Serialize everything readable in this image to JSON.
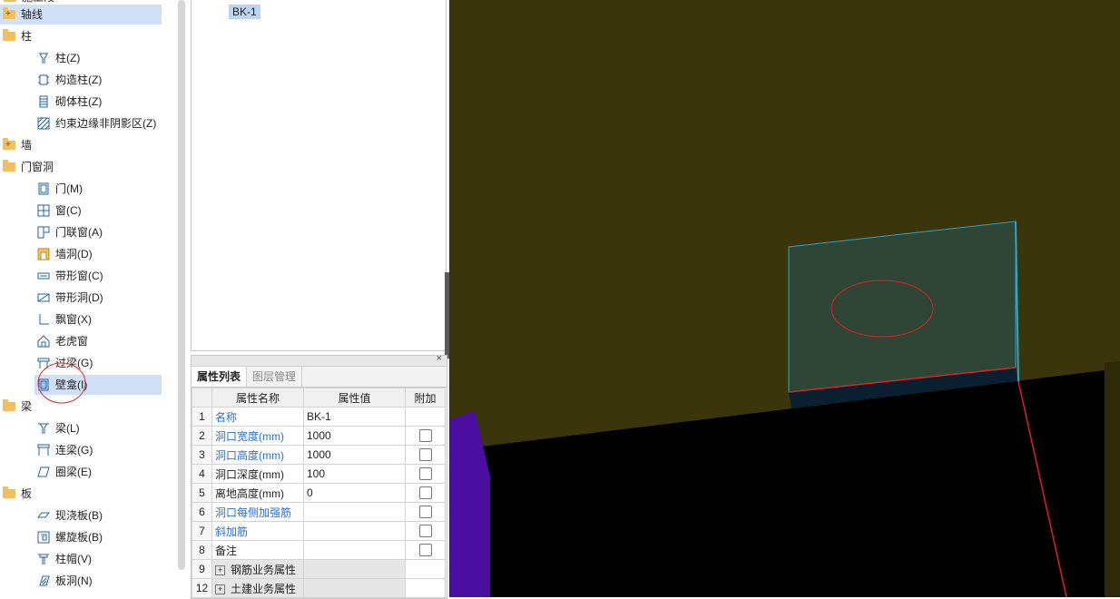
{
  "tree": {
    "top_cut_label": "施工段",
    "items": [
      {
        "label": "轴线",
        "type": "folder",
        "level": 0,
        "selected": true
      },
      {
        "label": "柱",
        "type": "folder",
        "level": 0
      },
      {
        "label": "柱(Z)",
        "type": "leaf",
        "icon": "column-icon",
        "level": 1
      },
      {
        "label": "构造柱(Z)",
        "type": "leaf",
        "icon": "structural-column-icon",
        "level": 1
      },
      {
        "label": "砌体柱(Z)",
        "type": "leaf",
        "icon": "masonry-column-icon",
        "level": 1
      },
      {
        "label": "约束边缘非阴影区(Z)",
        "type": "leaf",
        "icon": "hatched-zone-icon",
        "level": 1
      },
      {
        "label": "墙",
        "type": "folder",
        "level": 0
      },
      {
        "label": "门窗洞",
        "type": "folder",
        "level": 0
      },
      {
        "label": "门(M)",
        "type": "leaf",
        "icon": "door-icon",
        "level": 1
      },
      {
        "label": "窗(C)",
        "type": "leaf",
        "icon": "window-icon",
        "level": 1
      },
      {
        "label": "门联窗(A)",
        "type": "leaf",
        "icon": "door-window-icon",
        "level": 1
      },
      {
        "label": "墙洞(D)",
        "type": "leaf",
        "icon": "wall-hole-icon",
        "level": 1
      },
      {
        "label": "带形窗(C)",
        "type": "leaf",
        "icon": "strip-window-icon",
        "level": 1
      },
      {
        "label": "带形洞(D)",
        "type": "leaf",
        "icon": "strip-hole-icon",
        "level": 1
      },
      {
        "label": "飘窗(X)",
        "type": "leaf",
        "icon": "bay-window-icon",
        "level": 1
      },
      {
        "label": "老虎窗",
        "type": "leaf",
        "icon": "dormer-window-icon",
        "level": 1
      },
      {
        "label": "过梁(G)",
        "type": "leaf",
        "icon": "lintel-icon",
        "level": 1
      },
      {
        "label": "壁龛(I)",
        "type": "leaf",
        "icon": "niche-icon",
        "level": 1,
        "selected": true
      },
      {
        "label": "梁",
        "type": "folder",
        "level": 0
      },
      {
        "label": "梁(L)",
        "type": "leaf",
        "icon": "beam-icon",
        "level": 1
      },
      {
        "label": "连梁(G)",
        "type": "leaf",
        "icon": "coupling-beam-icon",
        "level": 1
      },
      {
        "label": "圈梁(E)",
        "type": "leaf",
        "icon": "ring-beam-icon",
        "level": 1
      },
      {
        "label": "板",
        "type": "folder",
        "level": 0
      },
      {
        "label": "现浇板(B)",
        "type": "leaf",
        "icon": "cast-slab-icon",
        "level": 1
      },
      {
        "label": "螺旋板(B)",
        "type": "leaf",
        "icon": "spiral-slab-icon",
        "level": 1
      },
      {
        "label": "柱帽(V)",
        "type": "leaf",
        "icon": "column-cap-icon",
        "level": 1
      },
      {
        "label": "板洞(N)",
        "type": "leaf",
        "icon": "slab-hole-icon",
        "level": 1
      }
    ]
  },
  "component_list": {
    "selected_item": "BK-1"
  },
  "properties": {
    "close_glyph": "×",
    "tabs": [
      {
        "label": "属性列表",
        "active": true
      },
      {
        "label": "图层管理",
        "active": false
      }
    ],
    "headers": {
      "name": "属性名称",
      "value": "属性值",
      "extra": "附加"
    },
    "rows": [
      {
        "num": "1",
        "name": "名称",
        "value": "BK-1",
        "blue": true,
        "checkbox": false
      },
      {
        "num": "2",
        "name": "洞口宽度(mm)",
        "value": "1000",
        "blue": true,
        "checkbox": true
      },
      {
        "num": "3",
        "name": "洞口高度(mm)",
        "value": "1000",
        "blue": true,
        "checkbox": true
      },
      {
        "num": "4",
        "name": "洞口深度(mm)",
        "value": "100",
        "blue": false,
        "checkbox": true
      },
      {
        "num": "5",
        "name": "离地高度(mm)",
        "value": "0",
        "blue": false,
        "checkbox": true
      },
      {
        "num": "6",
        "name": "洞口每侧加强筋",
        "value": "",
        "blue": true,
        "checkbox": true
      },
      {
        "num": "7",
        "name": "斜加筋",
        "value": "",
        "blue": true,
        "checkbox": true
      },
      {
        "num": "8",
        "name": "备注",
        "value": "",
        "blue": false,
        "checkbox": true
      },
      {
        "num": "9",
        "name": "钢筋业务属性",
        "value": "",
        "group": true
      },
      {
        "num": "12",
        "name": "土建业务属性",
        "value": "",
        "group": true
      }
    ]
  },
  "colors": {
    "wall": "#3a350b",
    "floor": "#000000",
    "niche_fill": "#2f4536",
    "niche_edge": "#2aa7c9",
    "column": "#4a0fa0",
    "highlight_red": "#e02020",
    "link_blue": "#2a6fd6"
  }
}
